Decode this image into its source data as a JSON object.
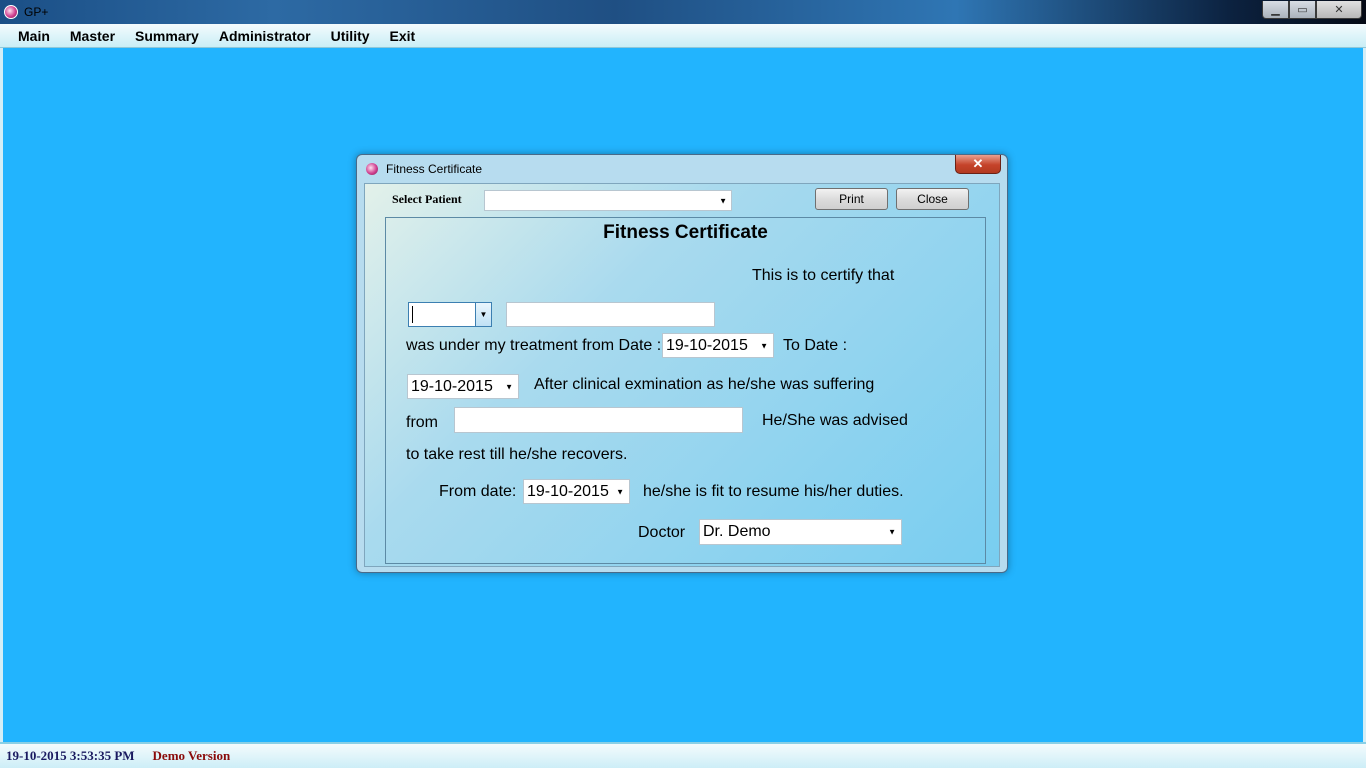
{
  "app": {
    "title": "GP+",
    "window_controls": {
      "minimize": "▁",
      "restore": "▭",
      "close": "✕"
    }
  },
  "menu": [
    "Main",
    "Master",
    "Summary",
    "Administrator",
    "Utility",
    "Exit"
  ],
  "status": {
    "datetime": "19-10-2015 3:53:35 PM",
    "version": "Demo Version"
  },
  "dialog": {
    "title": "Fitness Certificate",
    "close_glyph": "✕",
    "select_patient_label": "Select Patient",
    "select_patient_value": "",
    "print_label": "Print",
    "close_label": "Close",
    "form": {
      "heading": "Fitness Certificate",
      "certify_text": "This is to certify that",
      "salutation_value": "",
      "patient_name_value": "",
      "treatment_from_text": "was under my treatment from Date :",
      "from_date": "19-10-2015",
      "to_date_text": "To Date :",
      "to_date": "19-10-2015",
      "clinical_text": "After clinical exmination as he/she was suffering",
      "from_text": "from",
      "illness_value": "",
      "advised_text": "He/She was advised",
      "rest_text": "to take rest till he/she recovers.",
      "resume_from_label": "From date:",
      "resume_date": "19-10-2015",
      "fit_text": "he/she is  fit to resume his/her duties.",
      "doctor_label": "Doctor",
      "doctor_value": "Dr. Demo"
    }
  },
  "icons": {
    "dropdown": "▼"
  }
}
